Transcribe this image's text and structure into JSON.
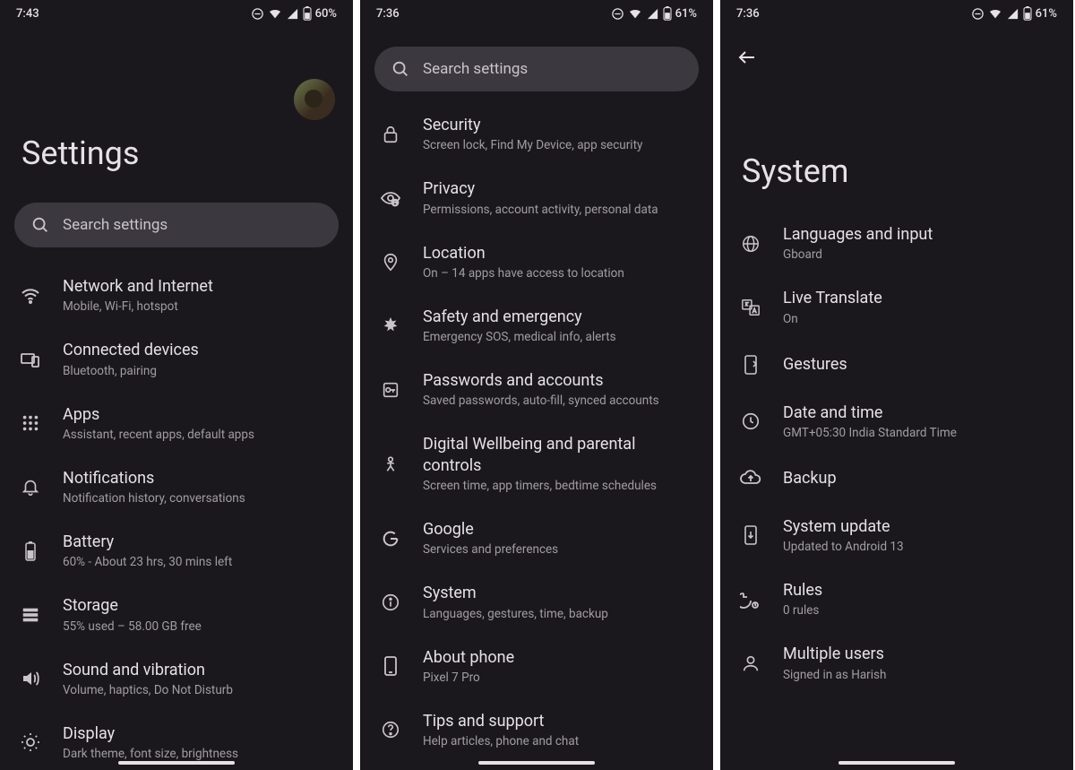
{
  "screen1": {
    "status": {
      "time": "7:43",
      "battery": "60%"
    },
    "title": "Settings",
    "search_placeholder": "Search settings",
    "items": [
      {
        "title": "Network and Internet",
        "sub": "Mobile, Wi-Fi, hotspot"
      },
      {
        "title": "Connected devices",
        "sub": "Bluetooth, pairing"
      },
      {
        "title": "Apps",
        "sub": "Assistant, recent apps, default apps"
      },
      {
        "title": "Notifications",
        "sub": "Notification history, conversations"
      },
      {
        "title": "Battery",
        "sub": "60% - About 23 hrs, 30 mins left"
      },
      {
        "title": "Storage",
        "sub": "55% used – 58.00 GB free"
      },
      {
        "title": "Sound and vibration",
        "sub": "Volume, haptics, Do Not Disturb"
      },
      {
        "title": "Display",
        "sub": "Dark theme, font size, brightness"
      }
    ]
  },
  "screen2": {
    "status": {
      "time": "7:36",
      "battery": "61%"
    },
    "search_placeholder": "Search settings",
    "items": [
      {
        "title": "Security",
        "sub": "Screen lock, Find My Device, app security"
      },
      {
        "title": "Privacy",
        "sub": "Permissions, account activity, personal data"
      },
      {
        "title": "Location",
        "sub": "On – 14 apps have access to location"
      },
      {
        "title": "Safety and emergency",
        "sub": "Emergency SOS, medical info, alerts"
      },
      {
        "title": "Passwords and accounts",
        "sub": "Saved passwords, auto-fill, synced accounts"
      },
      {
        "title": "Digital Wellbeing and parental controls",
        "sub": "Screen time, app timers, bedtime schedules"
      },
      {
        "title": "Google",
        "sub": "Services and preferences"
      },
      {
        "title": "System",
        "sub": "Languages, gestures, time, backup"
      },
      {
        "title": "About phone",
        "sub": "Pixel 7 Pro"
      },
      {
        "title": "Tips and support",
        "sub": "Help articles, phone and chat"
      }
    ]
  },
  "screen3": {
    "status": {
      "time": "7:36",
      "battery": "61%"
    },
    "title": "System",
    "items": [
      {
        "title": "Languages and input",
        "sub": "Gboard"
      },
      {
        "title": "Live Translate",
        "sub": "On"
      },
      {
        "title": "Gestures",
        "sub": ""
      },
      {
        "title": "Date and time",
        "sub": "GMT+05:30 India Standard Time"
      },
      {
        "title": "Backup",
        "sub": ""
      },
      {
        "title": "System update",
        "sub": "Updated to Android 13"
      },
      {
        "title": "Rules",
        "sub": "0 rules"
      },
      {
        "title": "Multiple users",
        "sub": "Signed in as Harish"
      }
    ]
  }
}
